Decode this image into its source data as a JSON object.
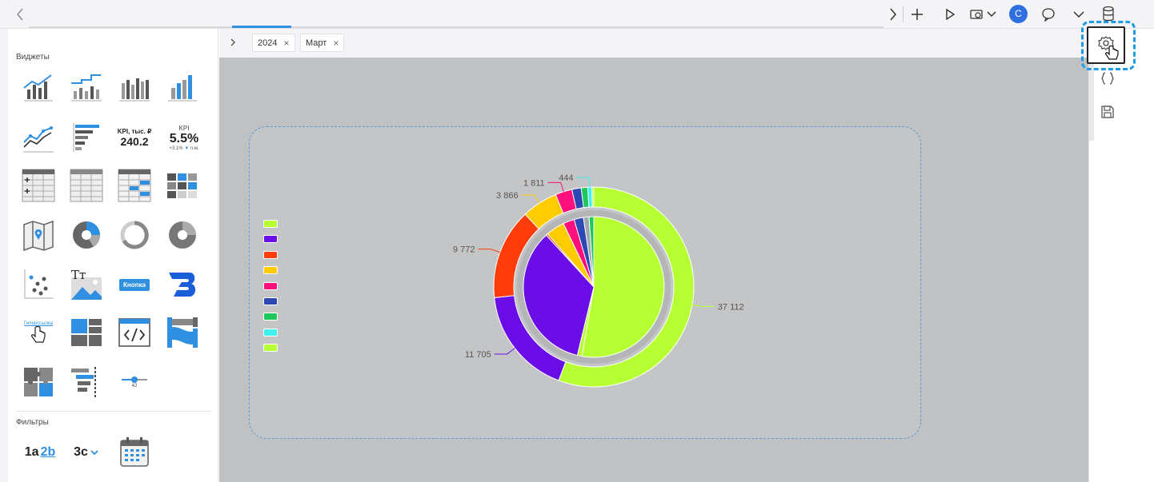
{
  "tabs": [
    {
      "label": "2024",
      "close": "×"
    },
    {
      "label": "Март",
      "close": "×"
    }
  ],
  "topbar": {
    "avatar_letter": "C"
  },
  "sidebar": {
    "widgets_title": "Виджеты",
    "filters_title": "Фильтры",
    "kpi_tile_1": {
      "title": "KPI, тыс. ₽",
      "value": "240.2"
    },
    "kpi_tile_2": {
      "title": "KPI",
      "value": "5.5%",
      "delta": "+3.1%",
      "delta_suffix": "п.м."
    },
    "button_tile_label": "Кнопка",
    "hyperlink_tile_label": "Гиперссылка",
    "slider_tile_value": "42",
    "filter_tile_1": {
      "part_a": "1a",
      "part_b": "2b"
    },
    "filter_tile_2": "3c"
  },
  "chart_data": {
    "type": "pie",
    "variant": "nested-donut",
    "outer_ring": {
      "values": [
        37112,
        11705,
        9772,
        3866,
        1811,
        1000,
        700,
        444,
        200
      ],
      "labels": [
        "37 112",
        "11 705",
        "9 772",
        "3 866",
        "1 811",
        "",
        "",
        "444",
        ""
      ],
      "colors": [
        "#b6ff33",
        "#6b0de6",
        "#ff3c0a",
        "#ffcc00",
        "#ff0f7b",
        "#2c48b5",
        "#1fc75a",
        "#3ff0ee",
        "#b6ff33"
      ]
    },
    "inner_pie": {
      "values": [
        49.0,
        1.0,
        32.0,
        0.4,
        4.0,
        2.4,
        2.0,
        1.2,
        1.0
      ],
      "colors": [
        "#b6ff33",
        "#b6ff33",
        "#6b0de6",
        "#ff3c0a",
        "#ffcc00",
        "#ff0f7b",
        "#2c48b5",
        "#a0a8ad",
        "#1fc75a"
      ]
    },
    "legend_colors": [
      "#b6ff33",
      "#6b0de6",
      "#ff3c0a",
      "#ffcc00",
      "#ff0f7b",
      "#2c48b5",
      "#1fc75a",
      "#3ff0ee",
      "#b6ff33"
    ]
  }
}
